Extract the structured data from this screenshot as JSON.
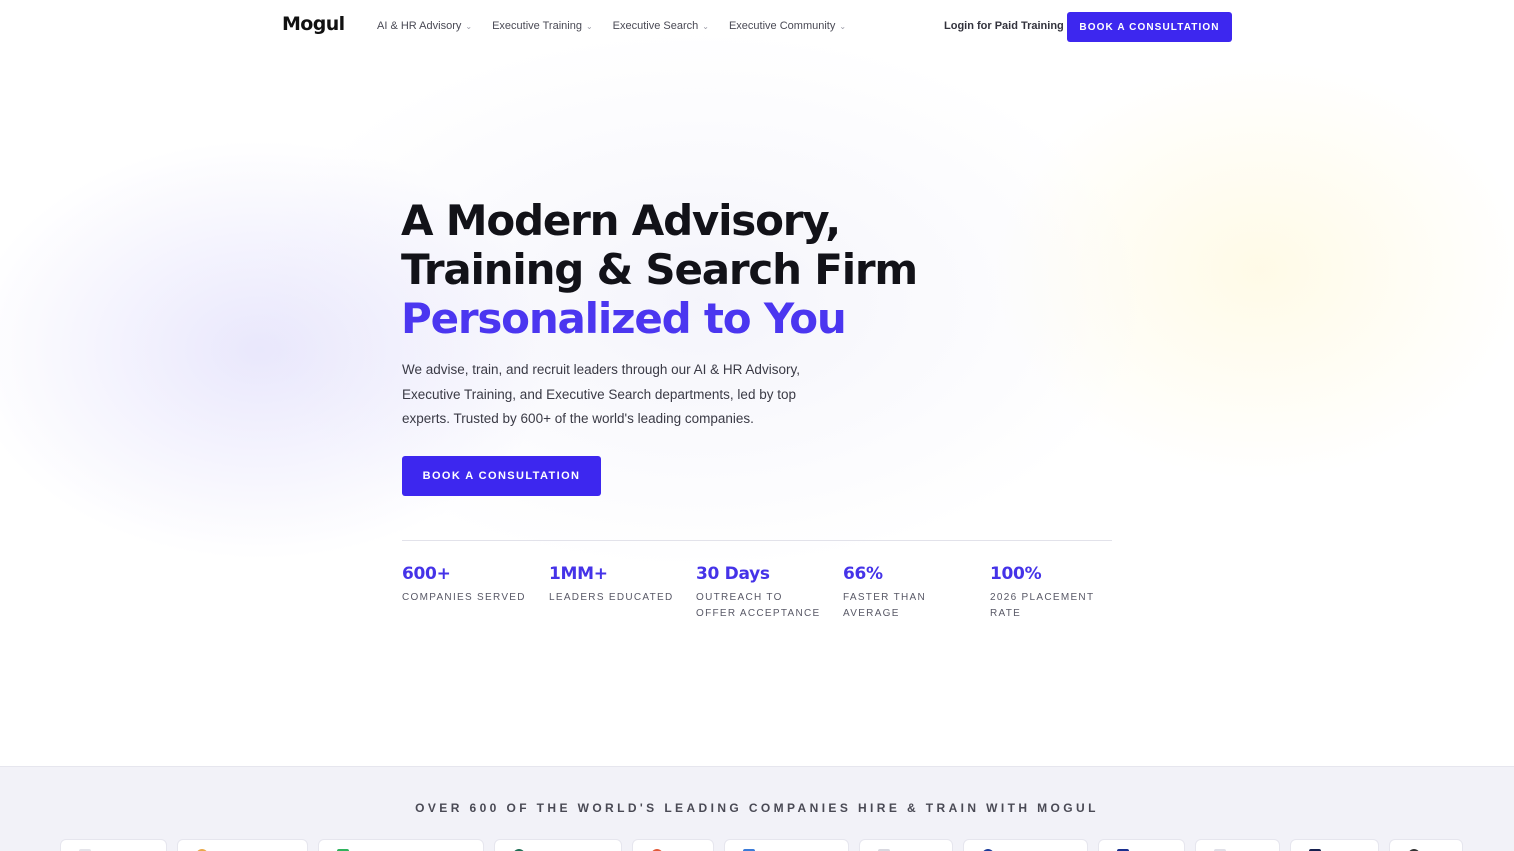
{
  "nav": {
    "logo": "Mogul",
    "items": [
      {
        "label": "AI & HR Advisory",
        "chevron": "chevron-down-icon"
      },
      {
        "label": "Executive Training",
        "chevron": "chevron-down-icon"
      },
      {
        "label": "Executive Search",
        "chevron": "chevron-down-icon"
      },
      {
        "label": "Executive Community",
        "chevron": "chevron-down-icon"
      }
    ],
    "login": "Login for Paid Training",
    "cta": "BOOK A CONSULTATION"
  },
  "hero": {
    "headline_line1": "A Modern Advisory,",
    "headline_line2": "Training & Search Firm",
    "headline_accent": "Personalized to You",
    "subtext": "We advise, train, and recruit leaders through our AI & HR Advisory, Executive Training, and Executive Search departments, led by top experts. Trusted by 600+ of the world's leading companies.",
    "cta": "BOOK A CONSULTATION"
  },
  "stats": [
    {
      "value": "600+",
      "label": "COMPANIES SERVED"
    },
    {
      "value": "1MM+",
      "label": "LEADERS EDUCATED"
    },
    {
      "value": "30 Days",
      "label": "OUTREACH TO OFFER ACCEPTANCE"
    },
    {
      "value": "66%",
      "label": "FASTER THAN AVERAGE"
    },
    {
      "value": "100%",
      "label": "2026 PLACEMENT RATE"
    }
  ],
  "clients": {
    "title": "OVER 600 OF THE WORLD'S LEADING COMPANIES HIRE & TRAIN WITH MOGUL"
  },
  "colors": {
    "accent": "#3d27ef",
    "accent_text": "#4b36f0",
    "strip_bg": "#f2f2f8"
  }
}
